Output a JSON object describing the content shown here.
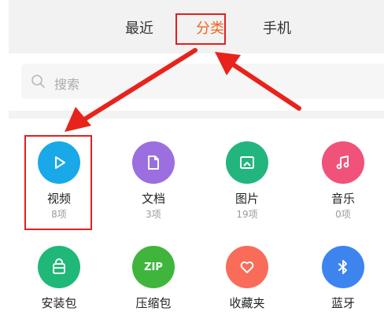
{
  "tabs": {
    "recent": "最近",
    "category": "分类",
    "phone": "手机"
  },
  "search": {
    "placeholder": "搜索"
  },
  "categories": [
    {
      "label": "视频",
      "count": "8项",
      "icon": "play-icon",
      "color": "#1aa9e8"
    },
    {
      "label": "文档",
      "count": "3项",
      "icon": "document-icon",
      "color": "#9b6fe0"
    },
    {
      "label": "图片",
      "count": "19项",
      "icon": "image-icon",
      "color": "#22b67e"
    },
    {
      "label": "音乐",
      "count": "0项",
      "icon": "music-icon",
      "color": "#f0527a"
    },
    {
      "label": "安装包",
      "icon": "package-icon",
      "color": "#1fb878"
    },
    {
      "label": "压缩包",
      "icon": "zip-icon",
      "icon_text": "ZIP",
      "color": "#3fb53c"
    },
    {
      "label": "收藏夹",
      "icon": "heart-icon",
      "color": "#f86c59"
    },
    {
      "label": "蓝牙",
      "icon": "bluetooth-icon",
      "color": "#3d84ef"
    }
  ],
  "colors": {
    "accent": "#f06522",
    "annotation": "#e02020"
  }
}
